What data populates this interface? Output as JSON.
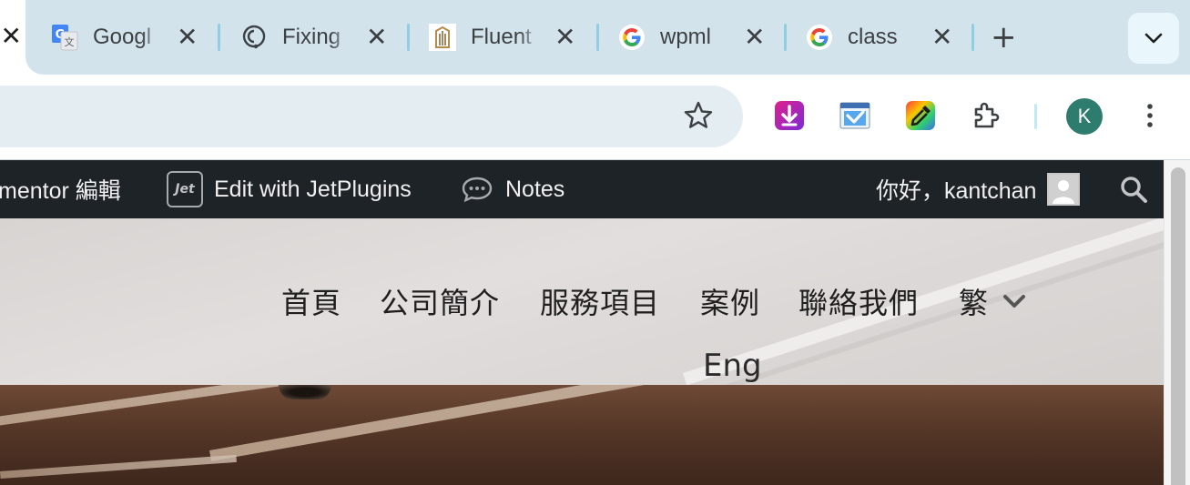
{
  "browser": {
    "active_tab_close": "✕",
    "tabs": [
      {
        "title": "Googl",
        "icon": "google-translate-icon"
      },
      {
        "title": "Fixing",
        "icon": "github-copilot-icon"
      },
      {
        "title": "Fluent",
        "icon": "fluent-site-icon"
      },
      {
        "title": "wpml",
        "icon": "google-icon"
      },
      {
        "title": "class",
        "icon": "google-icon"
      }
    ],
    "tab_close_glyph": "✕",
    "new_tab_glyph": "+",
    "profile_initial": "K"
  },
  "admin_bar": {
    "elementor_label": "mentor 編輯",
    "jet_logo_text": "Jet",
    "jetplugins_label": "Edit with JetPlugins",
    "notes_label": "Notes",
    "greeting": "你好，kantchan"
  },
  "site_nav": {
    "items": [
      "首頁",
      "公司簡介",
      "服務項目",
      "案例",
      "聯絡我們",
      "繁"
    ],
    "secondary": "Eng"
  },
  "colors": {
    "tab_strip": "#d3e3ec",
    "admin_bar": "#1d2327",
    "avatar": "#2e7c6e",
    "tab_separator": "#8fcfe0"
  }
}
